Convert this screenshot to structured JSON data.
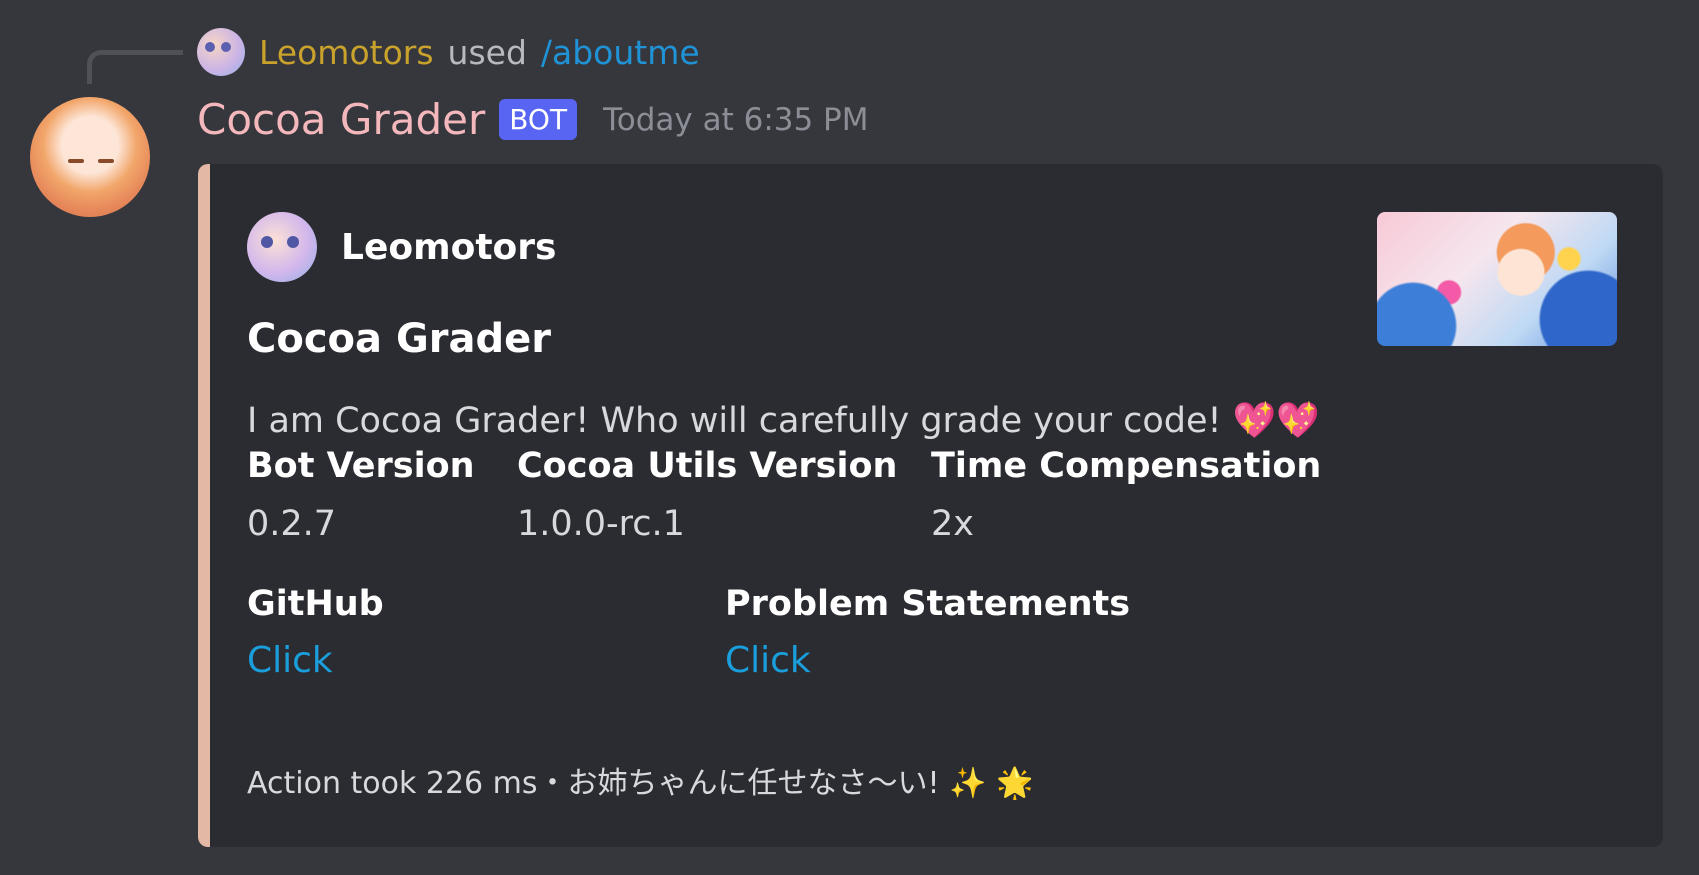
{
  "reply": {
    "user": "Leomotors",
    "used": "used",
    "command": "/aboutme"
  },
  "message": {
    "author": "Cocoa Grader",
    "badge": "BOT",
    "timestamp": "Today at 6:35 PM"
  },
  "embed": {
    "accent_color": "#e3b8a5",
    "author_name": "Leomotors",
    "title": "Cocoa Grader",
    "description": "I am Cocoa Grader! Who will carefully grade your code!",
    "description_emoji": "💖💖",
    "fields": [
      {
        "name": "Bot Version",
        "value": "0.2.7"
      },
      {
        "name": "Cocoa Utils Version",
        "value": "1.0.0-rc.1"
      },
      {
        "name": "Time Compensation",
        "value": "2x"
      },
      {
        "name": "GitHub",
        "value": "Click"
      },
      {
        "name": "Problem Statements",
        "value": "Click"
      }
    ],
    "footer": "Action took 226 ms・お姉ちゃんに任せなさ〜い! ✨ 🌟"
  }
}
